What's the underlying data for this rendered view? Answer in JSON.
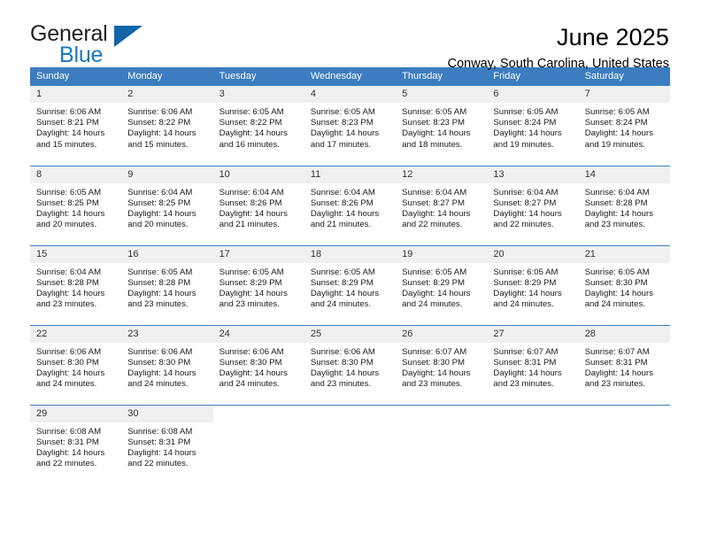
{
  "brand": {
    "line1": "General",
    "line2": "Blue",
    "mark_icon": "triangle-logo-icon",
    "accent_color": "#1878be",
    "mark_color": "#1064a8"
  },
  "header": {
    "title": "June 2025",
    "subtitle": "Conway, South Carolina, United States"
  },
  "calendar": {
    "header_bg": "#3b7dc0",
    "daynum_bg": "#f0f0f0",
    "weekday_headers": [
      "Sunday",
      "Monday",
      "Tuesday",
      "Wednesday",
      "Thursday",
      "Friday",
      "Saturday"
    ],
    "weeks": [
      [
        {
          "day": "1",
          "sunrise": "Sunrise: 6:06 AM",
          "sunset": "Sunset: 8:21 PM",
          "daylight_1": "Daylight: 14 hours",
          "daylight_2": "and 15 minutes."
        },
        {
          "day": "2",
          "sunrise": "Sunrise: 6:06 AM",
          "sunset": "Sunset: 8:22 PM",
          "daylight_1": "Daylight: 14 hours",
          "daylight_2": "and 15 minutes."
        },
        {
          "day": "3",
          "sunrise": "Sunrise: 6:05 AM",
          "sunset": "Sunset: 8:22 PM",
          "daylight_1": "Daylight: 14 hours",
          "daylight_2": "and 16 minutes."
        },
        {
          "day": "4",
          "sunrise": "Sunrise: 6:05 AM",
          "sunset": "Sunset: 8:23 PM",
          "daylight_1": "Daylight: 14 hours",
          "daylight_2": "and 17 minutes."
        },
        {
          "day": "5",
          "sunrise": "Sunrise: 6:05 AM",
          "sunset": "Sunset: 8:23 PM",
          "daylight_1": "Daylight: 14 hours",
          "daylight_2": "and 18 minutes."
        },
        {
          "day": "6",
          "sunrise": "Sunrise: 6:05 AM",
          "sunset": "Sunset: 8:24 PM",
          "daylight_1": "Daylight: 14 hours",
          "daylight_2": "and 19 minutes."
        },
        {
          "day": "7",
          "sunrise": "Sunrise: 6:05 AM",
          "sunset": "Sunset: 8:24 PM",
          "daylight_1": "Daylight: 14 hours",
          "daylight_2": "and 19 minutes."
        }
      ],
      [
        {
          "day": "8",
          "sunrise": "Sunrise: 6:05 AM",
          "sunset": "Sunset: 8:25 PM",
          "daylight_1": "Daylight: 14 hours",
          "daylight_2": "and 20 minutes."
        },
        {
          "day": "9",
          "sunrise": "Sunrise: 6:04 AM",
          "sunset": "Sunset: 8:25 PM",
          "daylight_1": "Daylight: 14 hours",
          "daylight_2": "and 20 minutes."
        },
        {
          "day": "10",
          "sunrise": "Sunrise: 6:04 AM",
          "sunset": "Sunset: 8:26 PM",
          "daylight_1": "Daylight: 14 hours",
          "daylight_2": "and 21 minutes."
        },
        {
          "day": "11",
          "sunrise": "Sunrise: 6:04 AM",
          "sunset": "Sunset: 8:26 PM",
          "daylight_1": "Daylight: 14 hours",
          "daylight_2": "and 21 minutes."
        },
        {
          "day": "12",
          "sunrise": "Sunrise: 6:04 AM",
          "sunset": "Sunset: 8:27 PM",
          "daylight_1": "Daylight: 14 hours",
          "daylight_2": "and 22 minutes."
        },
        {
          "day": "13",
          "sunrise": "Sunrise: 6:04 AM",
          "sunset": "Sunset: 8:27 PM",
          "daylight_1": "Daylight: 14 hours",
          "daylight_2": "and 22 minutes."
        },
        {
          "day": "14",
          "sunrise": "Sunrise: 6:04 AM",
          "sunset": "Sunset: 8:28 PM",
          "daylight_1": "Daylight: 14 hours",
          "daylight_2": "and 23 minutes."
        }
      ],
      [
        {
          "day": "15",
          "sunrise": "Sunrise: 6:04 AM",
          "sunset": "Sunset: 8:28 PM",
          "daylight_1": "Daylight: 14 hours",
          "daylight_2": "and 23 minutes."
        },
        {
          "day": "16",
          "sunrise": "Sunrise: 6:05 AM",
          "sunset": "Sunset: 8:28 PM",
          "daylight_1": "Daylight: 14 hours",
          "daylight_2": "and 23 minutes."
        },
        {
          "day": "17",
          "sunrise": "Sunrise: 6:05 AM",
          "sunset": "Sunset: 8:29 PM",
          "daylight_1": "Daylight: 14 hours",
          "daylight_2": "and 23 minutes."
        },
        {
          "day": "18",
          "sunrise": "Sunrise: 6:05 AM",
          "sunset": "Sunset: 8:29 PM",
          "daylight_1": "Daylight: 14 hours",
          "daylight_2": "and 24 minutes."
        },
        {
          "day": "19",
          "sunrise": "Sunrise: 6:05 AM",
          "sunset": "Sunset: 8:29 PM",
          "daylight_1": "Daylight: 14 hours",
          "daylight_2": "and 24 minutes."
        },
        {
          "day": "20",
          "sunrise": "Sunrise: 6:05 AM",
          "sunset": "Sunset: 8:29 PM",
          "daylight_1": "Daylight: 14 hours",
          "daylight_2": "and 24 minutes."
        },
        {
          "day": "21",
          "sunrise": "Sunrise: 6:05 AM",
          "sunset": "Sunset: 8:30 PM",
          "daylight_1": "Daylight: 14 hours",
          "daylight_2": "and 24 minutes."
        }
      ],
      [
        {
          "day": "22",
          "sunrise": "Sunrise: 6:06 AM",
          "sunset": "Sunset: 8:30 PM",
          "daylight_1": "Daylight: 14 hours",
          "daylight_2": "and 24 minutes."
        },
        {
          "day": "23",
          "sunrise": "Sunrise: 6:06 AM",
          "sunset": "Sunset: 8:30 PM",
          "daylight_1": "Daylight: 14 hours",
          "daylight_2": "and 24 minutes."
        },
        {
          "day": "24",
          "sunrise": "Sunrise: 6:06 AM",
          "sunset": "Sunset: 8:30 PM",
          "daylight_1": "Daylight: 14 hours",
          "daylight_2": "and 24 minutes."
        },
        {
          "day": "25",
          "sunrise": "Sunrise: 6:06 AM",
          "sunset": "Sunset: 8:30 PM",
          "daylight_1": "Daylight: 14 hours",
          "daylight_2": "and 23 minutes."
        },
        {
          "day": "26",
          "sunrise": "Sunrise: 6:07 AM",
          "sunset": "Sunset: 8:30 PM",
          "daylight_1": "Daylight: 14 hours",
          "daylight_2": "and 23 minutes."
        },
        {
          "day": "27",
          "sunrise": "Sunrise: 6:07 AM",
          "sunset": "Sunset: 8:31 PM",
          "daylight_1": "Daylight: 14 hours",
          "daylight_2": "and 23 minutes."
        },
        {
          "day": "28",
          "sunrise": "Sunrise: 6:07 AM",
          "sunset": "Sunset: 8:31 PM",
          "daylight_1": "Daylight: 14 hours",
          "daylight_2": "and 23 minutes."
        }
      ],
      [
        {
          "day": "29",
          "sunrise": "Sunrise: 6:08 AM",
          "sunset": "Sunset: 8:31 PM",
          "daylight_1": "Daylight: 14 hours",
          "daylight_2": "and 22 minutes."
        },
        {
          "day": "30",
          "sunrise": "Sunrise: 6:08 AM",
          "sunset": "Sunset: 8:31 PM",
          "daylight_1": "Daylight: 14 hours",
          "daylight_2": "and 22 minutes."
        },
        null,
        null,
        null,
        null,
        null
      ]
    ]
  }
}
